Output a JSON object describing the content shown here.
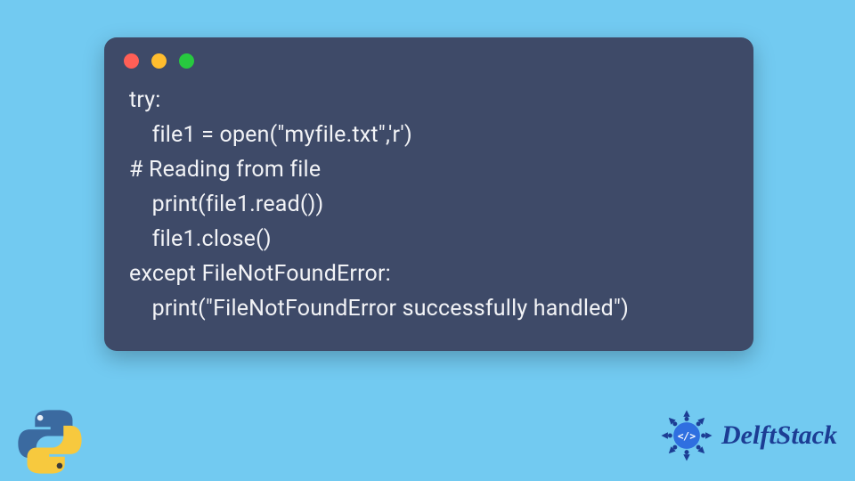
{
  "colors": {
    "bg": "#72caf1",
    "window": "#3e4a68",
    "text": "#f2f3f6",
    "dot_red": "#ff5f56",
    "dot_yellow": "#ffbd2e",
    "dot_green": "#27c93f",
    "delft_blue": "#1c3d94",
    "delft_accent": "#2f6fe0"
  },
  "code_lines": [
    "try:",
    "    file1 = open(\"myfile.txt\",'r')",
    "# Reading from file",
    "    print(file1.read())",
    "    file1.close()",
    "except FileNotFoundError:",
    "    print(\"FileNotFoundError successfully handled\")"
  ],
  "brand": {
    "name": "DelftStack"
  }
}
